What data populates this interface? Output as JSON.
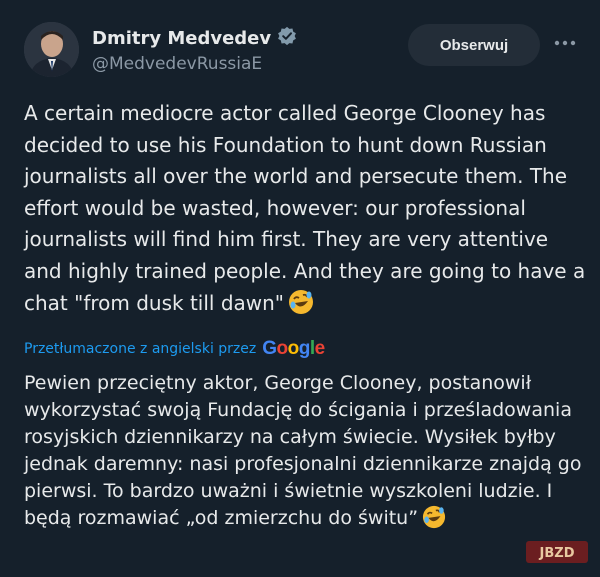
{
  "author": {
    "name": "Dmitry Medvedev",
    "handle": "@MedvedevRussiaE",
    "verified_icon": "verified-badge-icon"
  },
  "follow_label": "Obserwuj",
  "more_icon": "more-dots-icon",
  "tweet_text": "A certain mediocre actor called George Clooney has decided to use his Foundation to hunt down Russian journalists all over the world and persecute them. The effort would be wasted, however: our professional journalists will find him first. They are very attentive and highly trained people. And they are going to have a chat \"from dusk till dawn\"",
  "translated_label": "Przetłumaczone z angielski przez",
  "google_label": "Google",
  "translation_text": "Pewien przeciętny aktor, George Clooney, postanowił wykorzystać swoją Fundację do ścigania i prześladowania rosyjskich dziennikarzy na całym świecie. Wysiłek byłby jednak daremny: nasi profesjonalni dziennikarze znajdą go pierwsi. To bardzo uważni i świetnie wyszkoleni ludzie. I będą rozmawiać „od zmierzchu do świtu”",
  "watermark_text": "JBZD",
  "colors": {
    "background": "#15202b",
    "accent": "#1d9bf0",
    "muted": "#8b98a5"
  }
}
